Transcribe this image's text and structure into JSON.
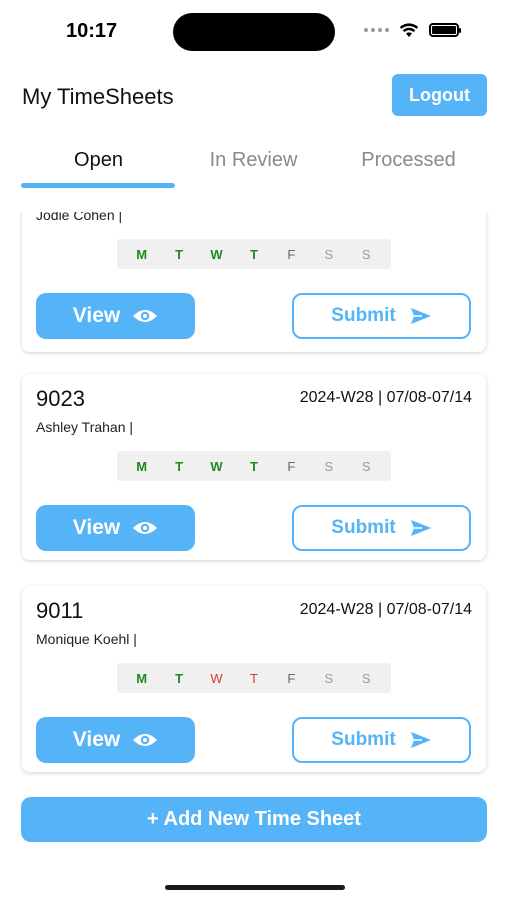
{
  "status_bar": {
    "time": "10:17"
  },
  "header": {
    "title": "My TimeSheets",
    "logout_label": "Logout"
  },
  "tabs": [
    {
      "label": "Open",
      "active": true
    },
    {
      "label": "In Review",
      "active": false
    },
    {
      "label": "Processed",
      "active": false
    }
  ],
  "cards": [
    {
      "id": "",
      "week": "",
      "name": "Jodie Cohen |",
      "days": [
        {
          "label": "M",
          "status": "green"
        },
        {
          "label": "T",
          "status": "green"
        },
        {
          "label": "W",
          "status": "green"
        },
        {
          "label": "T",
          "status": "green"
        },
        {
          "label": "F",
          "status": "dark"
        },
        {
          "label": "S",
          "status": "gray"
        },
        {
          "label": "S",
          "status": "gray"
        }
      ],
      "view_label": "View",
      "submit_label": "Submit"
    },
    {
      "id": "9023",
      "week": "2024-W28 | 07/08-07/14",
      "name": "Ashley Trahan |",
      "days": [
        {
          "label": "M",
          "status": "green"
        },
        {
          "label": "T",
          "status": "green"
        },
        {
          "label": "W",
          "status": "green"
        },
        {
          "label": "T",
          "status": "green"
        },
        {
          "label": "F",
          "status": "dark"
        },
        {
          "label": "S",
          "status": "gray"
        },
        {
          "label": "S",
          "status": "gray"
        }
      ],
      "view_label": "View",
      "submit_label": "Submit"
    },
    {
      "id": "9011",
      "week": "2024-W28 | 07/08-07/14",
      "name": "Monique Koehl |",
      "days": [
        {
          "label": "M",
          "status": "green"
        },
        {
          "label": "T",
          "status": "green"
        },
        {
          "label": "W",
          "status": "red"
        },
        {
          "label": "T",
          "status": "red"
        },
        {
          "label": "F",
          "status": "dark"
        },
        {
          "label": "S",
          "status": "gray"
        },
        {
          "label": "S",
          "status": "gray"
        }
      ],
      "view_label": "View",
      "submit_label": "Submit"
    }
  ],
  "add_button_label": "+ Add New Time Sheet",
  "colors": {
    "accent": "#55b3f8",
    "day_complete": "#1f8a1f",
    "day_missing": "#d23b3b",
    "day_pending": "#9a9a9a"
  }
}
